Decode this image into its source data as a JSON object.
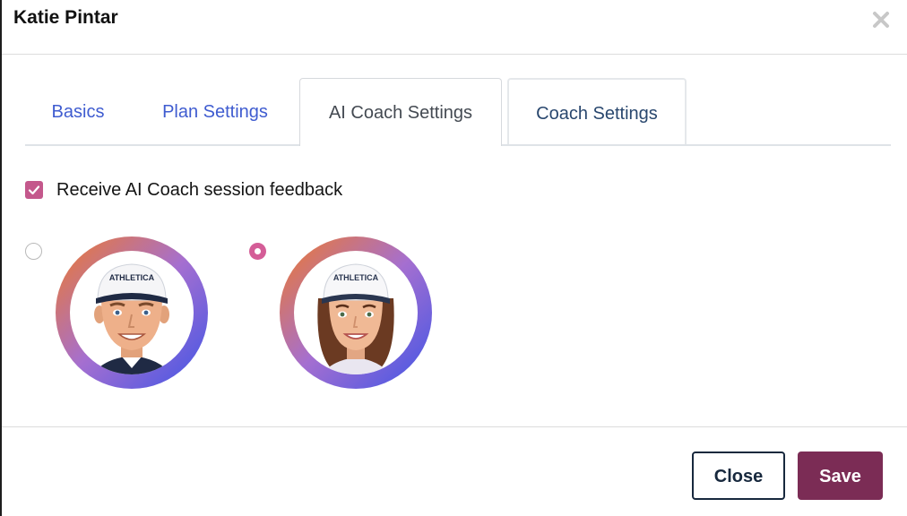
{
  "modal": {
    "title": "Katie Pintar",
    "close_icon": "close-x-icon"
  },
  "tabs": [
    {
      "label": "Basics",
      "active": false
    },
    {
      "label": "Plan Settings",
      "active": false
    },
    {
      "label": "AI Coach Settings",
      "active": true
    },
    {
      "label": "Coach Settings",
      "active": false
    }
  ],
  "feedback": {
    "checked": true,
    "label": "Receive AI Coach session feedback"
  },
  "coaches": [
    {
      "avatar": "male-coach-avatar",
      "selected": false,
      "cap_text": "ATHLETICA"
    },
    {
      "avatar": "female-coach-avatar",
      "selected": true,
      "cap_text": "ATHLETICA"
    }
  ],
  "footer": {
    "close_label": "Close",
    "save_label": "Save"
  },
  "colors": {
    "accent_pink": "#c4588c",
    "save_button": "#7b2c55",
    "tab_link": "#3f5cd0",
    "ring_orange": "#ef7a2a",
    "ring_purple": "#a56fd0",
    "ring_blue": "#3f55e6"
  }
}
